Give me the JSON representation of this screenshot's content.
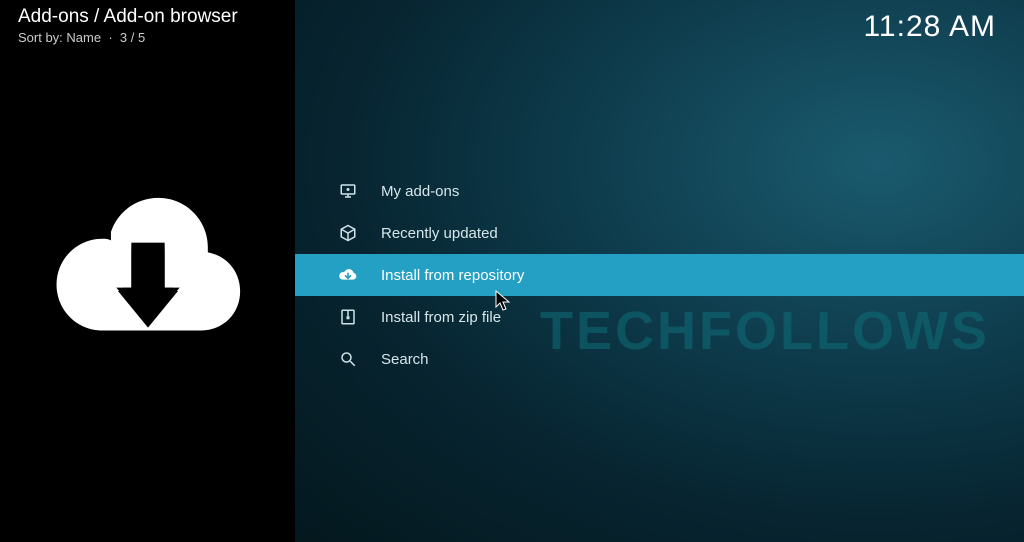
{
  "header": {
    "breadcrumb": "Add-ons / Add-on browser",
    "sort_prefix": "Sort by:",
    "sort_value": "Name",
    "position": "3 / 5"
  },
  "clock": "11:28 AM",
  "menu": {
    "items": [
      {
        "icon": "monitor-icon",
        "label": "My add-ons",
        "selected": false
      },
      {
        "icon": "box-icon",
        "label": "Recently updated",
        "selected": false
      },
      {
        "icon": "cloud-down-icon",
        "label": "Install from repository",
        "selected": true
      },
      {
        "icon": "zip-icon",
        "label": "Install from zip file",
        "selected": false
      },
      {
        "icon": "search-icon",
        "label": "Search",
        "selected": false
      }
    ]
  },
  "watermark": "TECHFOLLOWS",
  "colors": {
    "highlight": "#24a0c4",
    "bg_dark": "#000000",
    "text": "#d6e6ea"
  }
}
